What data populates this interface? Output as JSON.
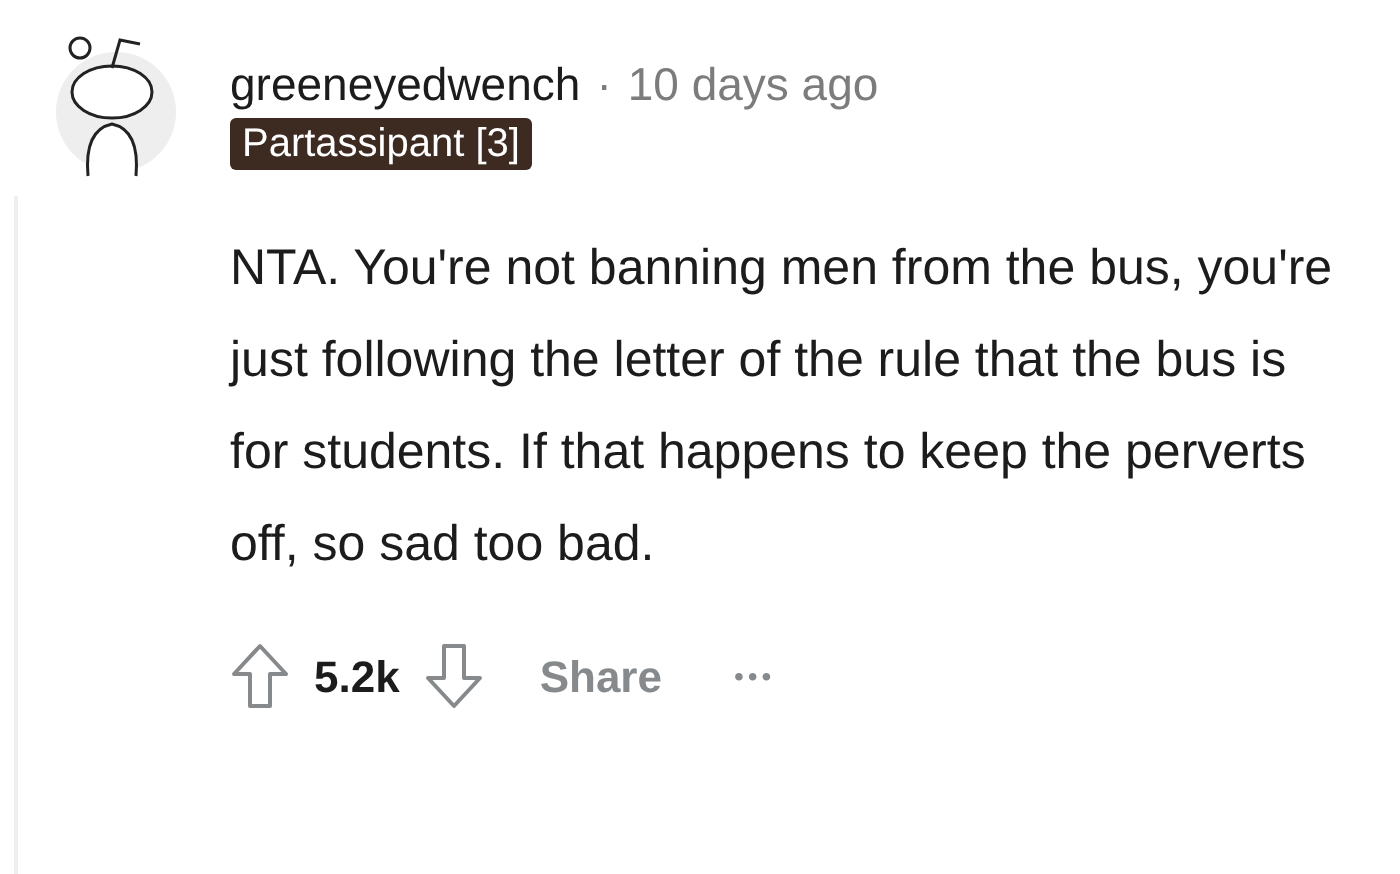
{
  "comment": {
    "author": "greeneyedwench",
    "separator": "·",
    "time": "10 days ago",
    "flair": "Partassipant [3]",
    "body": "NTA. You're not banning men from the bus, you're just following the letter of the rule that the bus is for students. If that happens to keep the perverts off, so sad too bad."
  },
  "actions": {
    "score": "5.2k",
    "share": "Share",
    "more": "•••"
  }
}
